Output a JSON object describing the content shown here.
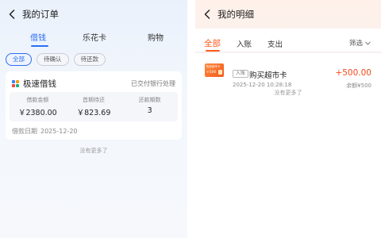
{
  "left": {
    "title": "我的订单",
    "tabs": [
      {
        "label": "借钱",
        "active": true
      },
      {
        "label": "乐花卡",
        "active": false
      },
      {
        "label": "购物",
        "active": false
      }
    ],
    "chips": [
      {
        "label": "全部",
        "active": true
      },
      {
        "label": "待确认",
        "active": false
      },
      {
        "label": "待还款",
        "active": false
      }
    ],
    "order": {
      "name": "极速借钱",
      "status": "已交付银行处理",
      "stats": [
        {
          "label": "借款金额",
          "value": "￥2380.00"
        },
        {
          "label": "首期待还",
          "value": "￥823.69"
        },
        {
          "label": "还款期数",
          "value": "3"
        }
      ],
      "date_label": "借款日期",
      "date_value": "2025-12-20"
    },
    "no_more": "没有更多了"
  },
  "right": {
    "title": "我的明细",
    "tabs": [
      {
        "label": "全部",
        "active": true
      },
      {
        "label": "入账",
        "active": false
      },
      {
        "label": "支出",
        "active": false
      }
    ],
    "filter": "筛选",
    "item": {
      "thumb_line1": "购买超市卡",
      "thumb_line2": "+500",
      "tag": "入账",
      "name": "购买超市卡",
      "time": "2025-12-20 10:28:18",
      "amount": "+500.00",
      "balance": "余额¥500"
    },
    "no_more": "没有更多了"
  },
  "colors": {
    "left_accent": "#2a6ef5",
    "right_accent": "#ff5a1f",
    "amount": "#f04a1a"
  },
  "icons": {
    "back": "chevron-left-icon",
    "app": "app-grid-icon",
    "filter": "chevron-down-icon"
  }
}
